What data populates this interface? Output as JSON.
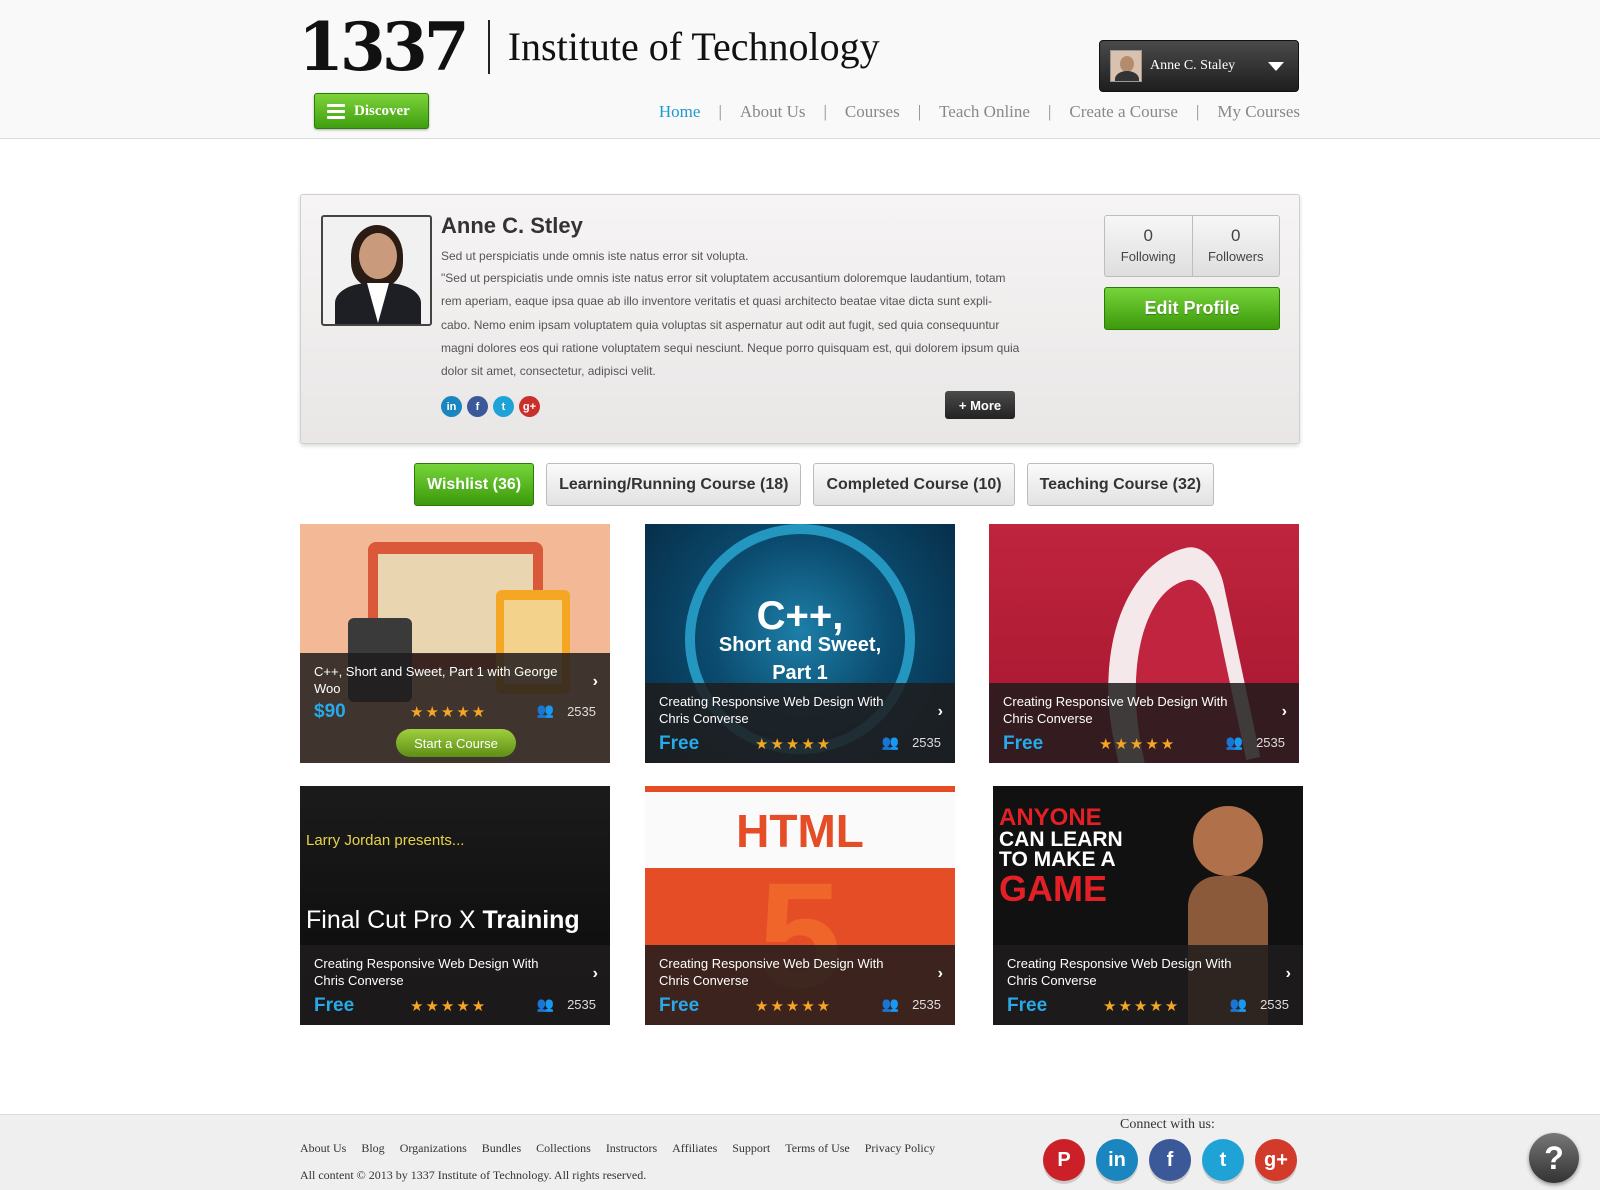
{
  "header": {
    "logo_number": "1337",
    "logo_name": "Institute of Technology",
    "discover_label": "Discover",
    "user_name": "Anne C. Staley",
    "nav": [
      {
        "label": "Home",
        "active": true
      },
      {
        "label": "About Us",
        "active": false
      },
      {
        "label": "Courses",
        "active": false
      },
      {
        "label": "Teach Online",
        "active": false
      },
      {
        "label": "Create a Course",
        "active": false
      },
      {
        "label": "My Courses",
        "active": false
      }
    ]
  },
  "profile": {
    "name": "Anne C. Stley",
    "subtitle": "Sed ut perspiciatis unde omnis iste natus error sit volupta.",
    "bio": "\"Sed ut perspiciatis unde omnis iste natus error sit voluptatem accusantium doloremque laudantium, totam rem aperiam, eaque ipsa quae ab illo inventore veritatis et quasi architecto beatae vitae dicta sunt expli-cabo. Nemo enim ipsam voluptatem quia voluptas sit aspernatur aut odit aut fugit, sed quia consequuntur magni dolores eos qui ratione voluptatem sequi nesciunt. Neque porro quisquam est, qui dolorem ipsum quia dolor sit amet, consectetur, adipisci velit.",
    "more_label": "+ More",
    "following_count": "0",
    "following_label": "Following",
    "followers_count": "0",
    "followers_label": "Followers",
    "edit_label": "Edit Profile",
    "social": [
      {
        "icon": "linkedin-icon",
        "glyph": "in",
        "color": "#1a85bf"
      },
      {
        "icon": "facebook-icon",
        "glyph": "f",
        "color": "#3b5998"
      },
      {
        "icon": "twitter-icon",
        "glyph": "t",
        "color": "#1fa3d6"
      },
      {
        "icon": "googleplus-icon",
        "glyph": "g+",
        "color": "#c9302c"
      }
    ]
  },
  "tabs": [
    {
      "label": "Wishlist (36)",
      "active": true
    },
    {
      "label": "Learning/Running Course (18)",
      "active": false
    },
    {
      "label": "Completed Course (10)",
      "active": false
    },
    {
      "label": "Teaching Course (32)",
      "active": false
    }
  ],
  "courses": [
    {
      "title": "C++, Short and Sweet, Part 1 with George Woo",
      "price": "$90",
      "count": "2535",
      "stars": "★★★★★",
      "start_label": "Start a Course"
    },
    {
      "title": "Creating Responsive Web Design With Chris Converse",
      "price": "Free",
      "count": "2535",
      "stars": "★★★★★",
      "art_line1": "C++,",
      "art_line2": "Short and Sweet,",
      "art_line3": "Part 1"
    },
    {
      "title": "Creating Responsive Web Design With Chris Converse",
      "price": "Free",
      "count": "2535",
      "stars": "★★★★★"
    },
    {
      "title": "Creating Responsive Web Design With Chris Converse",
      "price": "Free",
      "count": "2535",
      "stars": "★★★★★",
      "art_line1": "Larry Jordan presents...",
      "art_line2": "Final Cut Pro X",
      "art_line3": "Training"
    },
    {
      "title": "Creating Responsive Web Design With Chris Converse",
      "price": "Free",
      "count": "2535",
      "stars": "★★★★★",
      "art_line1": "HTML",
      "art_line2": "5"
    },
    {
      "title": "Creating Responsive Web Design With Chris Converse",
      "price": "Free",
      "count": "2535",
      "stars": "★★★★★",
      "art_line1": "ANYONE",
      "art_line2": "CAN LEARN",
      "art_line3": "TO MAKE A",
      "art_line4": "GAME"
    }
  ],
  "footer": {
    "links": [
      "About Us",
      "Blog",
      "Organizations",
      "Bundles",
      "Collections",
      "Instructors",
      "Affiliates",
      "Support",
      "Terms of Use",
      "Privacy Policy"
    ],
    "copyright": "All content © 2013 by 1337 Institute of Technology. All rights reserved.",
    "connect_label": "Connect with us:",
    "social": [
      {
        "icon": "pinterest-icon",
        "glyph": "P",
        "color": "#cb2027"
      },
      {
        "icon": "linkedin-icon",
        "glyph": "in",
        "color": "#1a85bf"
      },
      {
        "icon": "facebook-icon",
        "glyph": "f",
        "color": "#3b5998"
      },
      {
        "icon": "twitter-icon",
        "glyph": "t",
        "color": "#1fa3d6"
      },
      {
        "icon": "googleplus-icon",
        "glyph": "g+",
        "color": "#d23a2a"
      }
    ],
    "help_glyph": "?"
  }
}
